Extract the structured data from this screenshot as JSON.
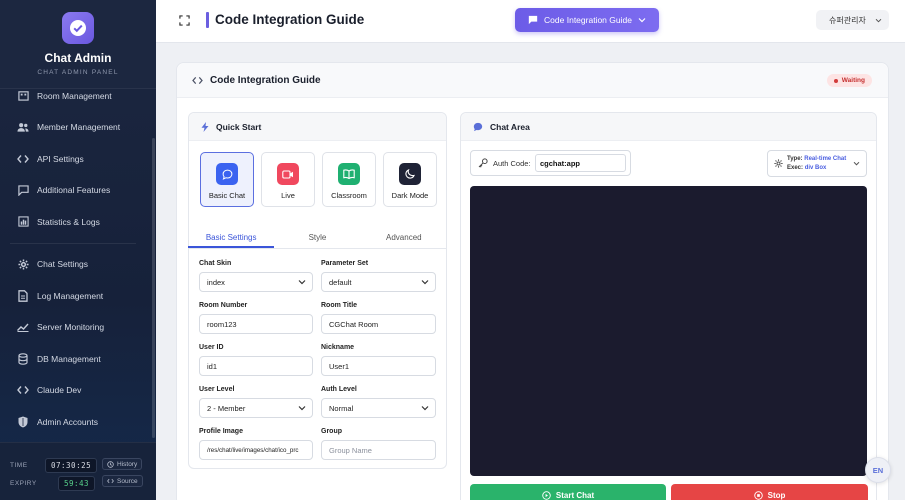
{
  "sidebar": {
    "title": "Chat Admin",
    "subtitle": "CHAT ADMIN PANEL",
    "items": [
      {
        "label": "Room Management"
      },
      {
        "label": "Member Management"
      },
      {
        "label": "API Settings"
      },
      {
        "label": "Additional Features"
      },
      {
        "label": "Statistics & Logs"
      },
      {
        "label": "Chat Settings"
      },
      {
        "label": "Log Management"
      },
      {
        "label": "Server Monitoring"
      },
      {
        "label": "DB Management"
      },
      {
        "label": "Claude Dev"
      },
      {
        "label": "Admin Accounts"
      }
    ],
    "footer": {
      "time_label": "TIME",
      "time_value": "07:30:25",
      "expiry_label": "EXPIRY",
      "expiry_value": "59:43",
      "history_label": "History",
      "source_label": "Source"
    }
  },
  "topbar": {
    "page_title": "Code Integration Guide",
    "guide_button": "Code Integration Guide",
    "user": "슈퍼관리자"
  },
  "card": {
    "title": "Code Integration Guide",
    "status": "Waiting"
  },
  "quick_start": {
    "title": "Quick Start",
    "tiles": [
      {
        "label": "Basic Chat",
        "color": "#3b63f0"
      },
      {
        "label": "Live",
        "color": "#f0485e"
      },
      {
        "label": "Classroom",
        "color": "#1fb071"
      },
      {
        "label": "Dark Mode",
        "color": "#1f2336"
      }
    ],
    "tabs": [
      "Basic Settings",
      "Style",
      "Advanced"
    ]
  },
  "form": {
    "chat_skin_label": "Chat Skin",
    "chat_skin_value": "index",
    "param_set_label": "Parameter Set",
    "param_set_value": "default",
    "room_number_label": "Room Number",
    "room_number_value": "room123",
    "room_title_label": "Room Title",
    "room_title_value": "CGChat Room",
    "user_id_label": "User ID",
    "user_id_value": "id1",
    "nickname_label": "Nickname",
    "nickname_value": "User1",
    "user_level_label": "User Level",
    "user_level_value": "2 - Member",
    "auth_level_label": "Auth Level",
    "auth_level_value": "Normal",
    "profile_image_label": "Profile Image",
    "profile_image_value": "/res/chat/live/images/chat/ico_prc",
    "group_label": "Group",
    "group_placeholder": "Group Name"
  },
  "chat_area": {
    "title": "Chat Area",
    "auth_label": "Auth Code:",
    "auth_value": "cgchat:app",
    "type_label": "Type:",
    "type_value": "Real-time Chat",
    "exec_label": "Exec:",
    "exec_value": "div Box",
    "start_button": "Start Chat",
    "stop_button": "Stop"
  },
  "lang_button": "EN",
  "colors": {
    "accent": "#6c5ce7",
    "sidebar_bg": "#1c2740",
    "start": "#2ab36b",
    "stop": "#e64545",
    "status_waiting": "#c53030"
  }
}
